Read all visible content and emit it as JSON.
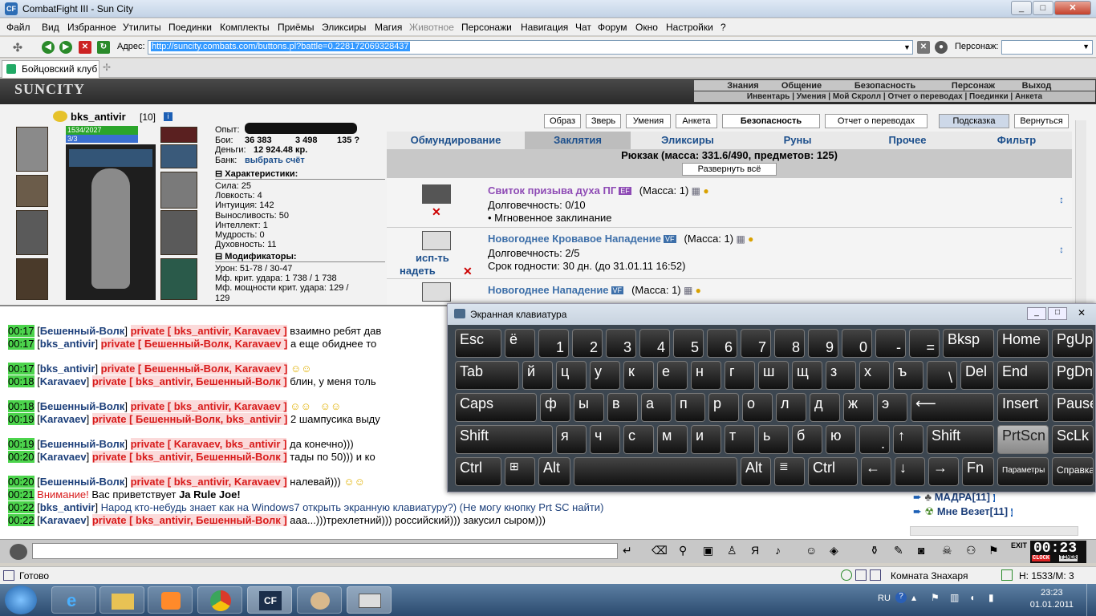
{
  "window": {
    "title": "CombatFight III - Sun City",
    "min": "_",
    "max": "□",
    "close": "✕"
  },
  "menu": [
    "Файл",
    "Вид",
    "Избранное",
    "Утилиты",
    "Поединки",
    "Комплекты",
    "Приёмы",
    "Эликсиры",
    "Магия",
    "Животное",
    "Персонажи",
    "Навигация",
    "Чат",
    "Форум",
    "Окно",
    "Настройки",
    "?"
  ],
  "address": {
    "label": "Адрес:",
    "url": "http://suncity.combats.com/buttons.pl?battle=0.228172069328437",
    "person_label": "Персонаж:"
  },
  "tab": {
    "label": "Бойцовский клуб"
  },
  "game": {
    "logo": "SUNCITY",
    "nav_top": [
      "Знания",
      "Общение",
      "Безопасность",
      "Персонаж",
      "Выход"
    ],
    "nav_bottom": "Инвентарь | Умения | Мой Скролл | Отчет о переводах | Поединки | Анкета",
    "char": {
      "name": "bks_antivir",
      "level": "[10]",
      "hp": "1534/2027",
      "mana": "3/3"
    },
    "stats": {
      "exp": "Опыт:",
      "fights": "Бои:",
      "fights_val": "36 383",
      "fights_val2": "3 498",
      "fights_val3": "135 ?",
      "money_label": "Деньги:",
      "money": "12 924.48 кр.",
      "bank_label": "Банк:",
      "bank": "выбрать счёт",
      "char_head": "Характеристики:",
      "attrs": [
        "Сила: 25",
        "Ловкость: 4",
        "Интуиция: 142",
        "Выносливость: 50",
        "Интеллект: 1",
        "Мудрость: 0",
        "Духовность: 11"
      ],
      "mod_head": "Модификаторы:",
      "mods": [
        "Урон: 51-78 / 30-47",
        "Мф. крит. удара: 1 738 / 1 738",
        "Мф. мощности крит. удара: 129 /",
        "129"
      ]
    },
    "topbtns": [
      "Образ",
      "Зверь",
      "Умения",
      "Анкета",
      "Безопасность",
      "Отчет о переводах",
      "Подсказка",
      "Вернуться"
    ],
    "cats": [
      "Обмундирование",
      "Заклятия",
      "Эликсиры",
      "Руны",
      "Прочее",
      "Фильтр"
    ],
    "backpack": "Рюкзак (масса: 331.6/490, предметов: 125)",
    "expand": "Развернуть всё",
    "items": [
      {
        "name": "Свиток призыва духа ПГ",
        "badge": "EF",
        "mass": "(Масса: 1)",
        "l1": "Долговечность: 0/10",
        "l2": "• Мгновенное заклинание",
        "l3": ""
      },
      {
        "name": "Новогоднее Кровавое Нападение",
        "badge": "VF",
        "mass": "(Масса: 1)",
        "l1": "Долговечность: 2/5",
        "l2": "Срок годности: 30 дн. (до 31.01.11 16:52)",
        "l3": "исп-ть",
        "l4": "надеть"
      },
      {
        "name": "Новогоднее Нападение",
        "badge": "VF",
        "mass": "(Масса: 1)"
      }
    ]
  },
  "chat": [
    {
      "t": "00:17",
      "n": "Бешенный-Волк",
      "p": "private [ bks_antivir, Karavaev ]",
      "m": "взаимно ребят дав"
    },
    {
      "t": "00:17",
      "n": "bks_antivir",
      "p": "private [ Бешенный-Волк, Karavaev ]",
      "m": "а еще обиднее то"
    },
    {
      "t": "00:17",
      "n": "bks_antivir",
      "p": "private [ Бешенный-Волк, Karavaev ]",
      "m": ""
    },
    {
      "t": "00:18",
      "n": "Karavaev",
      "p": "private [ bks_antivir, Бешенный-Волк ]",
      "m": "блин, у меня толь"
    },
    {
      "t": "00:18",
      "n": "Бешенный-Волк",
      "p": "private [ bks_antivir, Karavaev ]",
      "m": ""
    },
    {
      "t": "00:19",
      "n": "Karavaev",
      "p": "private [ Бешенный-Волк, bks_antivir ]",
      "m": "2 шампусика выду"
    },
    {
      "t": "00:19",
      "n": "Бешенный-Волк",
      "p": "private [ Karavaev, bks_antivir ]",
      "m": "да конечно)))"
    },
    {
      "t": "00:20",
      "n": "Karavaev",
      "p": "private [ bks_antivir, Бешенный-Волк ]",
      "m": "тады по 50))) и ко"
    },
    {
      "t": "00:20",
      "n": "Бешенный-Волк",
      "p": "private [ bks_antivir, Karavaev ]",
      "m": "налевай)))"
    },
    {
      "t": "00:21",
      "attn": "Внимание!",
      "m": "Вас приветствует",
      "who": "Ja Rule Joe!"
    },
    {
      "t": "00:22",
      "n": "bks_antivir",
      "m": "Народ кто-небудь знает как на Windows7 открыть экранную клавиатуру?) (Не могу кнопку Prt SC найти)"
    },
    {
      "t": "00:22",
      "n": "Karavaev",
      "p": "private [ bks_antivir, Бешенный-Волк ]",
      "m": "ааа...)))трехлетний))) российский))) закусил сыром)))"
    }
  ],
  "users": [
    "МАДРА[11]",
    "Мне Везет[11]"
  ],
  "osk": {
    "title": "Экранная клавиатура",
    "r1": [
      "Esc",
      "ё",
      "1",
      "2",
      "3",
      "4",
      "5",
      "6",
      "7",
      "8",
      "9",
      "0",
      "-",
      "=",
      "Bksp",
      "Home",
      "PgUp"
    ],
    "r2": [
      "Tab",
      "й",
      "ц",
      "у",
      "к",
      "е",
      "н",
      "г",
      "ш",
      "щ",
      "з",
      "х",
      "ъ",
      "\\",
      "Del",
      "End",
      "PgDn"
    ],
    "r3": [
      "Caps",
      "ф",
      "ы",
      "в",
      "а",
      "п",
      "р",
      "о",
      "л",
      "д",
      "ж",
      "э",
      "⟵",
      "Insert",
      "Pause"
    ],
    "r4": [
      "Shift",
      "я",
      "ч",
      "с",
      "м",
      "и",
      "т",
      "ь",
      "б",
      "ю",
      ".",
      "↑",
      "Shift",
      "PrtScn",
      "ScLk"
    ],
    "r5": [
      "Ctrl",
      "⊞",
      "Alt",
      "",
      "Alt",
      "≣",
      "Ctrl",
      "←",
      "↓",
      "→",
      "Fn",
      "Параметры",
      "Справка"
    ]
  },
  "timer": "00:23",
  "timer_labels": [
    "CLOCK",
    "TIMER"
  ],
  "status": {
    "left": "Готово",
    "room": "Комната Знахаря",
    "hm": "Н: 1533/М: 3"
  },
  "taskbar": {
    "lang": "RU",
    "time": "23:23",
    "date": "01.01.2011"
  }
}
